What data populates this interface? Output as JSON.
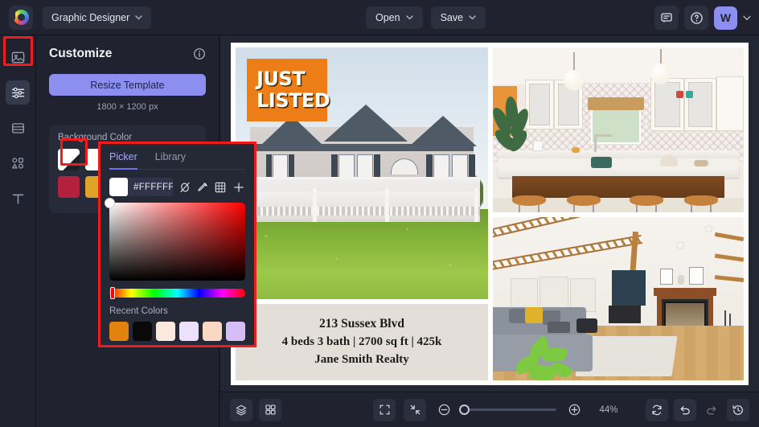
{
  "header": {
    "logo": "brand-logo",
    "doctype_label": "Graphic Designer",
    "open_label": "Open",
    "save_label": "Save",
    "comment_icon": "comment-icon",
    "help_icon": "help-icon",
    "avatar_initial": "W",
    "chevron": "⌄"
  },
  "rail": {
    "items": [
      {
        "icon": "image-icon",
        "name": "photos"
      },
      {
        "icon": "sliders-icon",
        "name": "customize"
      },
      {
        "icon": "layout-icon",
        "name": "templates"
      },
      {
        "icon": "shapes-icon",
        "name": "elements"
      },
      {
        "icon": "text-icon",
        "name": "text"
      }
    ]
  },
  "panel": {
    "title": "Customize",
    "info_icon": "info-icon",
    "resize_label": "Resize Template",
    "dimensions": "1800 × 1200 px",
    "bg_label": "Background Color",
    "swatches_row1": [
      "#ffffff",
      "#ffffff",
      "#ffffff"
    ],
    "swatches_row2": [
      "#b3213c",
      "#e0a32a",
      "#ffffff"
    ]
  },
  "picker": {
    "tabs": [
      {
        "label": "Picker",
        "active": true
      },
      {
        "label": "Library",
        "active": false
      }
    ],
    "hex_value": "#FFFFFF",
    "swatch_color": "#ffffff",
    "tools": [
      "no-color-icon",
      "eyedropper-icon",
      "palette-grid-icon",
      "add-icon"
    ],
    "hue_degrees": 0,
    "recent_label": "Recent Colors",
    "recent_colors": [
      "#e2820f",
      "#090909",
      "#fbe9de",
      "#ece0fa",
      "#fbd8c4",
      "#d7bdf5"
    ]
  },
  "canvas": {
    "badge": {
      "line1": "JUST",
      "line2": "LISTED",
      "color": "#ed7d17"
    },
    "caption": {
      "address": "213 Sussex Blvd",
      "details": "4 beds 3 bath | 2700 sq ft | 425k",
      "realty": "Jane Smith Realty",
      "bg": "#e3dfd8"
    },
    "photos": [
      {
        "name": "house-exterior-photo"
      },
      {
        "name": "kitchen-photo"
      },
      {
        "name": "living-room-photo"
      }
    ]
  },
  "bottombar": {
    "layers_icon": "layers-icon",
    "grid_icon": "grid-icon",
    "fit_icon": "fit-screen-icon",
    "collapse_icon": "collapse-icon",
    "zoom_out_icon": "zoom-out-icon",
    "zoom_in_icon": "zoom-in-icon",
    "zoom_value": "44%",
    "refresh_icon": "refresh-icon",
    "undo_icon": "undo-icon",
    "redo_icon": "redo-icon",
    "history_icon": "history-icon"
  },
  "accent": "#8c8ff0",
  "highlight": "#f01c1c"
}
